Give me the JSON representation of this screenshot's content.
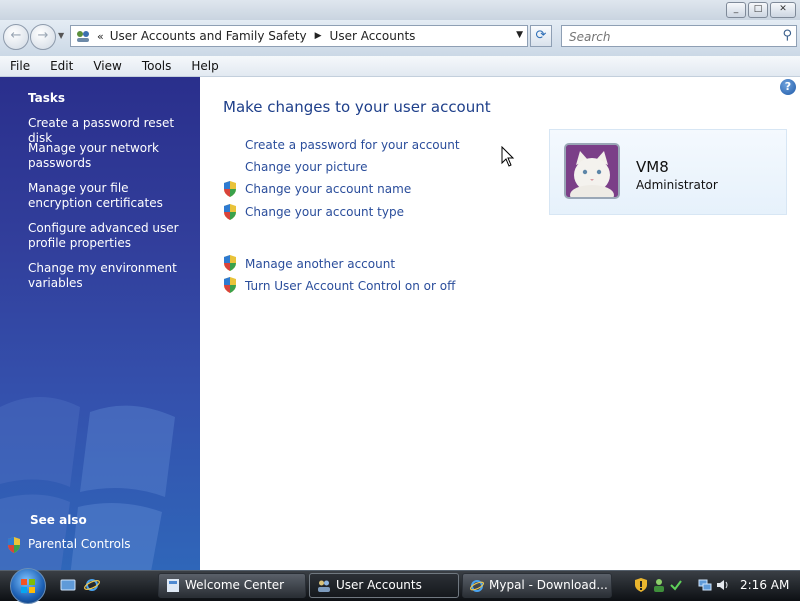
{
  "window": {
    "minimize_glyph": "_",
    "maximize_glyph": "□",
    "close_glyph": "✕"
  },
  "address_bar": {
    "back_glyph": "←",
    "forward_glyph": "→",
    "overflow_glyph": "«",
    "breadcrumbs": [
      "User Accounts and Family Safety",
      "User Accounts"
    ],
    "separator_glyph": "▶",
    "dropdown_glyph": "▼",
    "refresh_glyph": "⟳",
    "search_placeholder": "Search",
    "search_glyph": "⚲"
  },
  "menu": [
    "File",
    "Edit",
    "View",
    "Tools",
    "Help"
  ],
  "sidebar": {
    "tasks_title": "Tasks",
    "tasks": [
      "Create a password reset disk",
      "Manage your network passwords",
      "Manage your file encryption certificates",
      "Configure advanced user profile properties",
      "Change my environment variables"
    ],
    "see_also_title": "See also",
    "see_also": [
      "Parental Controls"
    ]
  },
  "main": {
    "help_glyph": "?",
    "title": "Make changes to your user account",
    "actions": [
      {
        "label": "Create a password for your account",
        "shield": false
      },
      {
        "label": "Change your picture",
        "shield": false
      },
      {
        "label": "Change your account name",
        "shield": true
      },
      {
        "label": "Change your account type",
        "shield": true
      },
      {
        "label": "Manage another account",
        "shield": true
      },
      {
        "label": "Turn User Account Control on or off",
        "shield": true
      }
    ],
    "account": {
      "name": "VM8",
      "role": "Administrator",
      "avatar": "white-cat-picture-icon"
    }
  },
  "taskbar": {
    "buttons": [
      {
        "label": "Welcome Center",
        "icon": "welcome-center-icon",
        "active": false
      },
      {
        "label": "User Accounts",
        "icon": "user-accounts-icon",
        "active": true
      },
      {
        "label": "Mypal - Download...",
        "icon": "mypal-browser-icon",
        "active": false
      }
    ],
    "clock": "2:16 AM"
  },
  "colors": {
    "sidebar": "#2f3e9c",
    "link": "#2a4d9b",
    "title": "#1e3f8a",
    "taskbar": "#1a1d22"
  }
}
